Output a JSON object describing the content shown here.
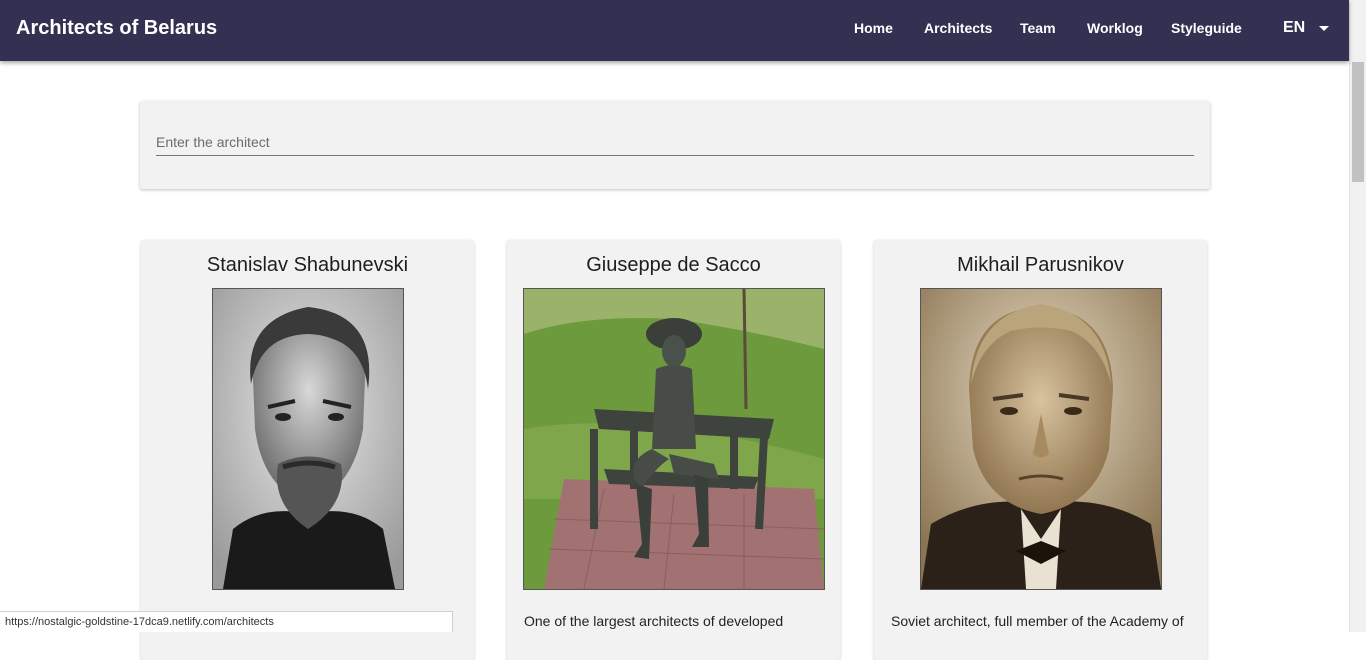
{
  "header": {
    "brand": "Architects of Belarus",
    "nav": [
      "Home",
      "Architects",
      "Team",
      "Worklog",
      "Styleguide"
    ],
    "language": "EN",
    "background": "#333052"
  },
  "search": {
    "placeholder": "Enter the architect",
    "value": ""
  },
  "cards": [
    {
      "name": "Stanislav Shabunevski",
      "description": "",
      "photo": "portrait-photo"
    },
    {
      "name": "Giuseppe de Sacco",
      "description": "One of the largest architects of developed",
      "photo": "statue-photo"
    },
    {
      "name": "Mikhail Parusnikov",
      "description": "Soviet architect, full member of the Academy of",
      "photo": "portrait-photo"
    }
  ],
  "status_bar": {
    "url": "https://nostalgic-goldstine-17dca9.netlify.com/architects"
  }
}
